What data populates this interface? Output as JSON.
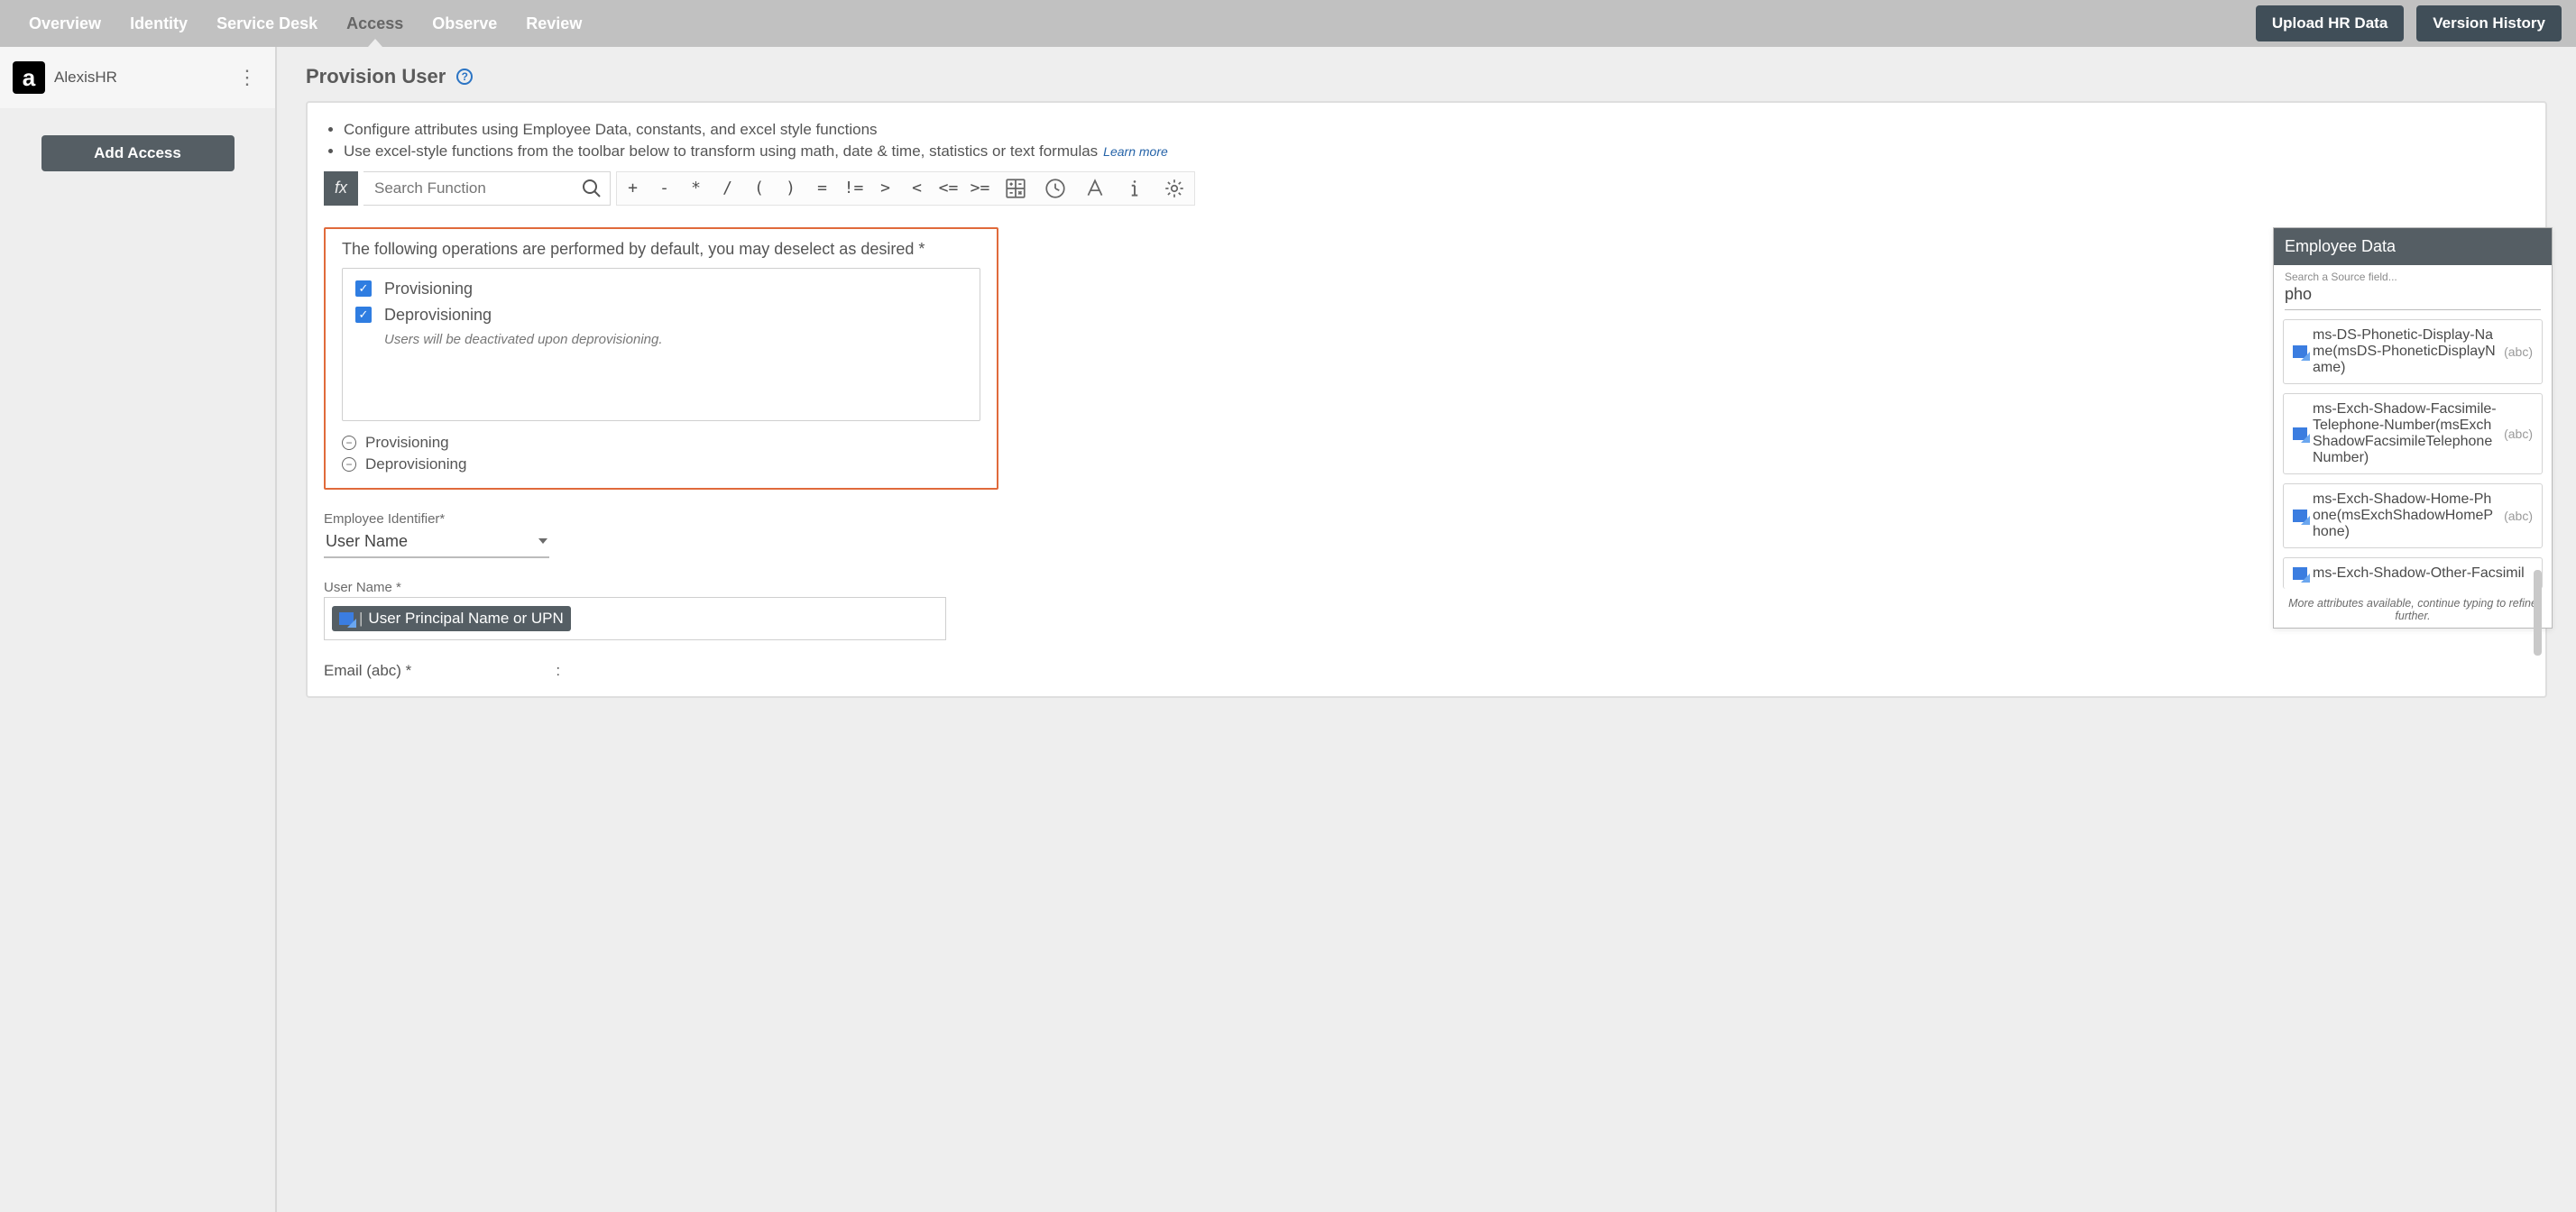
{
  "topbar": {
    "tabs": [
      "Overview",
      "Identity",
      "Service Desk",
      "Access",
      "Observe",
      "Review"
    ],
    "activeIndex": 3,
    "uploadBtn": "Upload HR Data",
    "versionBtn": "Version History"
  },
  "sidebar": {
    "appName": "AlexisHR",
    "addAccess": "Add Access"
  },
  "page": {
    "title": "Provision User",
    "introBullets": [
      "Configure attributes using Employee Data, constants, and excel style functions",
      "Use excel-style functions from the toolbar below to transform using math, date & time, statistics or text formulas"
    ],
    "learnMore": "Learn more",
    "fxLabel": "fx",
    "searchFnPlaceholder": "Search Function",
    "operators": [
      "+",
      "-",
      "*",
      "/",
      "(",
      ")",
      "=",
      "!=",
      ">",
      "<",
      "<=",
      ">="
    ]
  },
  "opsBox": {
    "note": "The following operations are performed by default, you may deselect as desired *",
    "items": [
      {
        "label": "Provisioning",
        "checked": true
      },
      {
        "label": "Deprovisioning",
        "checked": true,
        "hint": "Users will be deactivated upon deprovisioning."
      }
    ],
    "summary": [
      "Provisioning",
      "Deprovisioning"
    ]
  },
  "fields": {
    "empIdLabel": "Employee Identifier*",
    "empIdValue": "User Name",
    "userNameLabel": "User Name *",
    "userNameToken": "User Principal Name or UPN",
    "emailLabel": "Email (abc) *",
    "colon": ":"
  },
  "empPanel": {
    "header": "Employee Data",
    "searchPlaceholder": "Search a Source field...",
    "searchValue": "pho",
    "results": [
      {
        "text": "ms-DS-Phonetic-Display-Name(msDS-PhoneticDisplayName)",
        "type": "(abc)"
      },
      {
        "text": "ms-Exch-Shadow-Facsimile-Telephone-Number(msExchShadowFacsimileTelephoneNumber)",
        "type": "(abc)"
      },
      {
        "text": "ms-Exch-Shadow-Home-Phone(msExchShadowHomePhone)",
        "type": "(abc)"
      },
      {
        "text": "ms-Exch-Shadow-Other-Facsimil",
        "type": ""
      }
    ],
    "footer": "More attributes available, continue typing to refine further."
  }
}
